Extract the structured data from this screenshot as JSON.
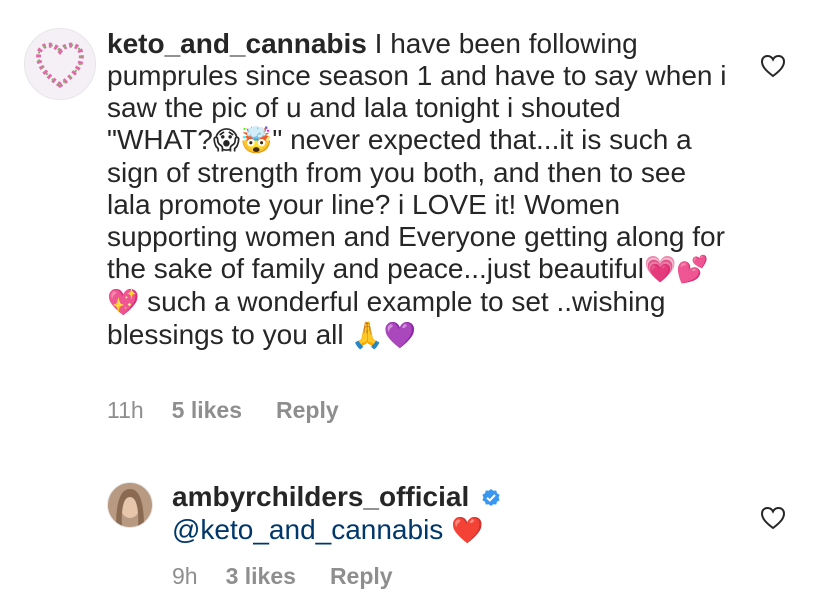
{
  "comment": {
    "username": "keto_and_cannabis",
    "text_part1": "I have been following pumprules since season 1 and have to say when i saw the pic of u and lala tonight i shouted \"WHAT?",
    "emoji_1": "😱🤯",
    "text_part2": "\" never expected that...it is such a sign of strength from you both, and then to see lala promote your line? i LOVE it! Women supporting women and Everyone getting along for the sake of family and peace...just beautiful",
    "emoji_2": "💗💕💖",
    "text_part3": " such a wonderful example to set ..wishing blessings to you all ",
    "emoji_3": "🙏💜",
    "time": "11h",
    "likes": "5 likes",
    "reply": "Reply",
    "like_icon": "heart-outline-icon"
  },
  "reply": {
    "username": "ambyrchilders_official",
    "verified": true,
    "mention": "@keto_and_cannabis",
    "emoji": "❤️",
    "time": "9h",
    "likes": "3 likes",
    "reply": "Reply",
    "like_icon": "heart-outline-icon"
  },
  "colors": {
    "text": "#262626",
    "meta": "#8e8e8e",
    "mention": "#00376b",
    "verified": "#3897f0"
  }
}
